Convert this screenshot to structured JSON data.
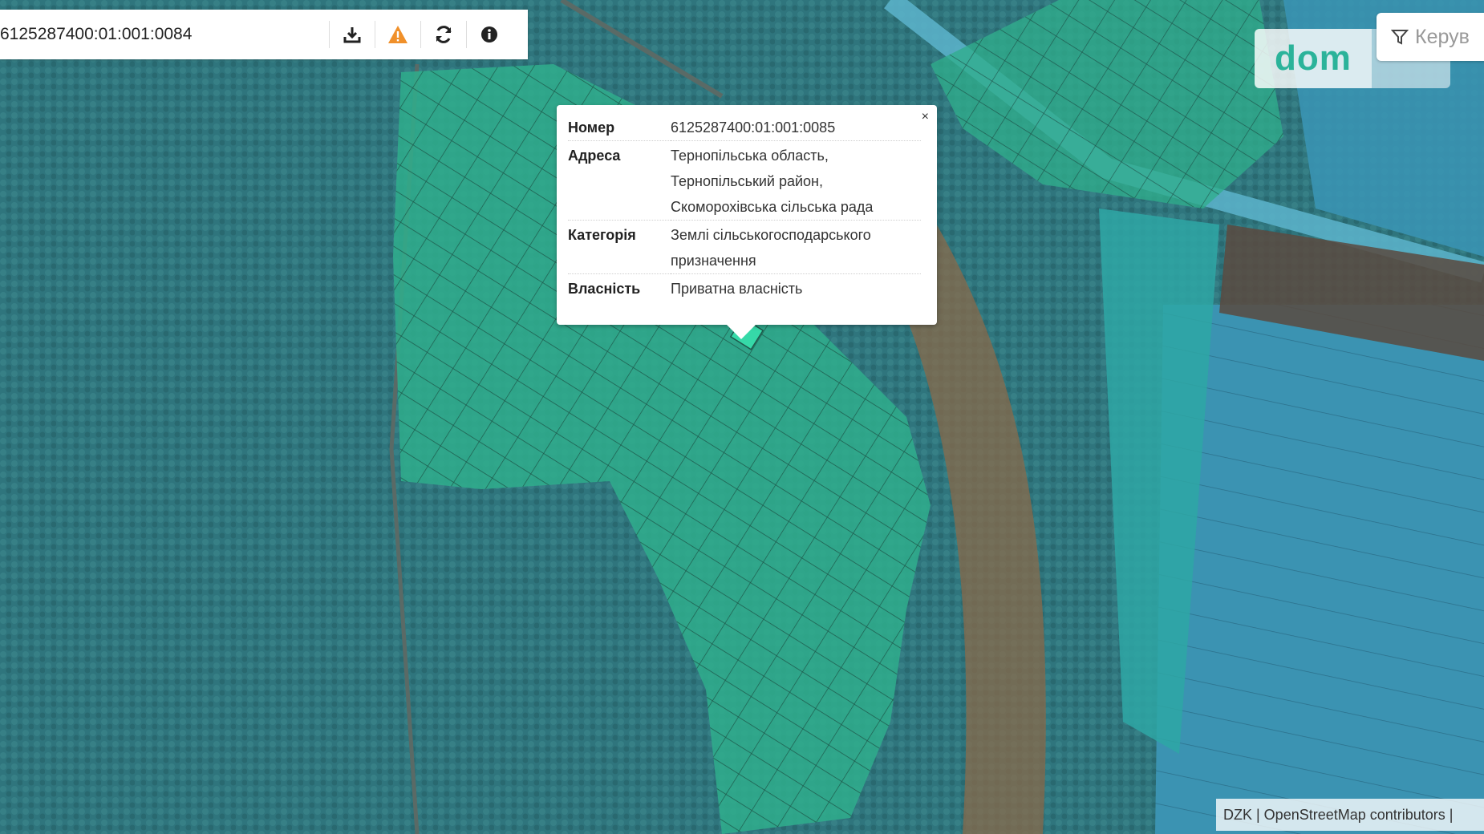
{
  "toolbar": {
    "search_value": "6125287400:01:001:0084",
    "download_icon": "download-icon",
    "warning_icon": "warning-icon",
    "warning_color": "#f0902a",
    "refresh_icon": "refresh-icon",
    "info_icon": "info-icon"
  },
  "popup": {
    "close_label": "×",
    "rows": [
      {
        "key": "Номер",
        "value": "6125287400:01:001:0085"
      },
      {
        "key": "Адреса",
        "value": "Тернопільська область, Тернопільський район, Скоморохівська сільська рада"
      },
      {
        "key": "Категорія",
        "value": "Землі сільськогосподарського призначення"
      },
      {
        "key": "Власність",
        "value": "Приватна власність"
      }
    ]
  },
  "filter": {
    "label": "Керув",
    "icon": "filter-icon"
  },
  "logo": {
    "text": "dom"
  },
  "attribution": {
    "text": "DZK | OpenStreetMap contributors | "
  },
  "colors": {
    "parcel_fill": "#2fc79a",
    "parcel_blue": "#3aa3c8",
    "water": "#2f6f7a"
  }
}
